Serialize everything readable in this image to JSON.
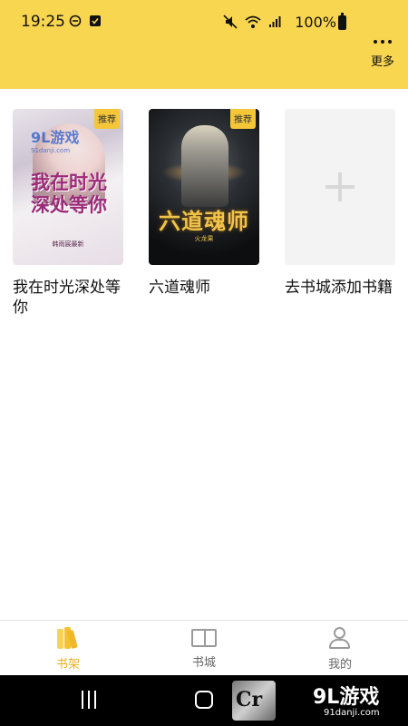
{
  "status_bar": {
    "time": "19:25",
    "battery": "100%",
    "icons": [
      "do-not-disturb-icon",
      "checkbox-notification-icon",
      "mute-icon",
      "wifi-icon",
      "signal-icon",
      "battery-icon"
    ]
  },
  "header": {
    "more_label": "更多",
    "background": "#f9d64f"
  },
  "books": [
    {
      "title": "我在时光深处等你",
      "badge": "推荐",
      "cover_text": "我在时光深处等你",
      "cover_author": "韩雨宸最新",
      "watermark": "9L游戏",
      "watermark_url": "91danji.com"
    },
    {
      "title": "六道魂师",
      "badge": "推荐",
      "cover_text": "六道魂师",
      "cover_author": "火龙果"
    }
  ],
  "add_book": {
    "label": "去书城添加书籍"
  },
  "bottom_nav": {
    "items": [
      {
        "label": "书架",
        "active": true
      },
      {
        "label": "书城",
        "active": false
      },
      {
        "label": "我的",
        "active": false
      }
    ],
    "active_color": "#e8b21f"
  },
  "system_nav": {
    "brand": "9L游戏",
    "brand_url": "91danji.com",
    "overlay_text": "Cr"
  }
}
